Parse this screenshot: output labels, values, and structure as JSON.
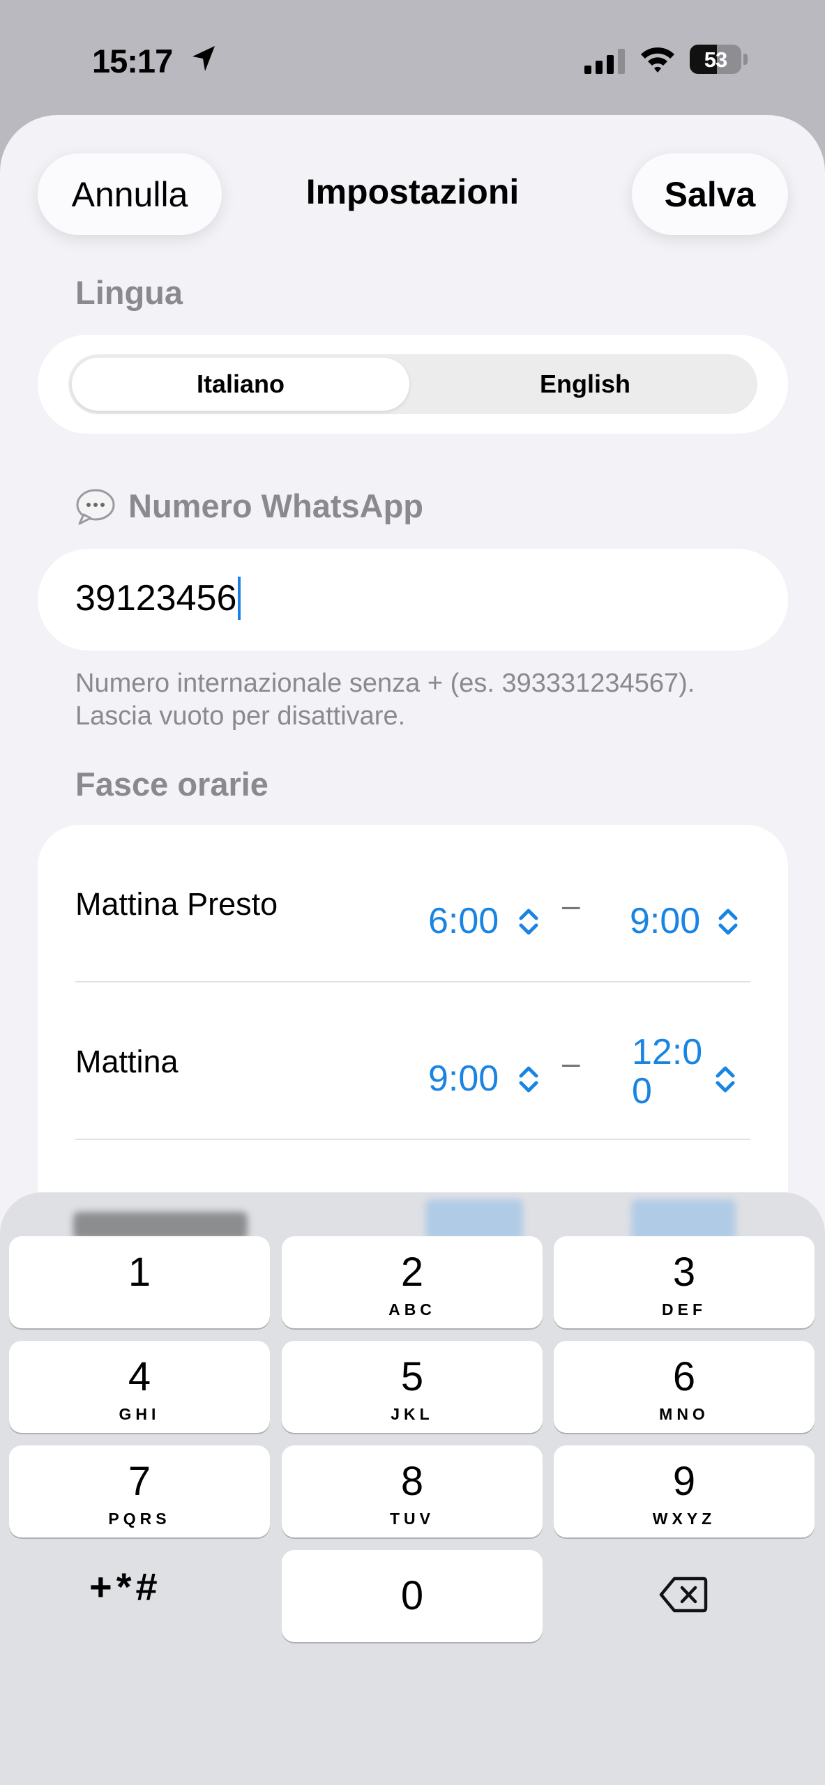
{
  "status_bar": {
    "time": "15:17",
    "battery": "53",
    "battery_level_percent": 53,
    "icons": [
      "location-arrow-icon",
      "cellular-signal-icon",
      "wifi-icon",
      "battery-icon"
    ]
  },
  "header": {
    "cancel_label": "Annulla",
    "title": "Impostazioni",
    "save_label": "Salva"
  },
  "language": {
    "section_label": "Lingua",
    "options": [
      "Italiano",
      "English"
    ],
    "selected": "Italiano"
  },
  "whatsapp": {
    "section_label": "Numero WhatsApp",
    "icon": "speech-bubble-icon",
    "value": "39123456",
    "hint": "Numero internazionale senza + (es. 393331234567). Lascia vuoto per disattivare."
  },
  "time_slots": {
    "section_label": "Fasce orarie",
    "separator": "–",
    "rows": [
      {
        "name": "Mattina Presto",
        "start": "6:00",
        "end": "9:00"
      },
      {
        "name": "Mattina",
        "start": "9:00",
        "end": "12:0\n0"
      }
    ]
  },
  "keypad": {
    "keys": [
      {
        "digit": "1",
        "letters": ""
      },
      {
        "digit": "2",
        "letters": "ABC"
      },
      {
        "digit": "3",
        "letters": "DEF"
      },
      {
        "digit": "4",
        "letters": "GHI"
      },
      {
        "digit": "5",
        "letters": "JKL"
      },
      {
        "digit": "6",
        "letters": "MNO"
      },
      {
        "digit": "7",
        "letters": "PQRS"
      },
      {
        "digit": "8",
        "letters": "TUV"
      },
      {
        "digit": "9",
        "letters": "WXYZ"
      },
      {
        "digit": "0",
        "letters": ""
      }
    ],
    "symbols_label": "+*#",
    "delete_icon": "backspace-icon"
  },
  "colors": {
    "accent": "#1a84e3",
    "secondary_text": "#8a8a8e",
    "background": "#f2f2f7"
  }
}
